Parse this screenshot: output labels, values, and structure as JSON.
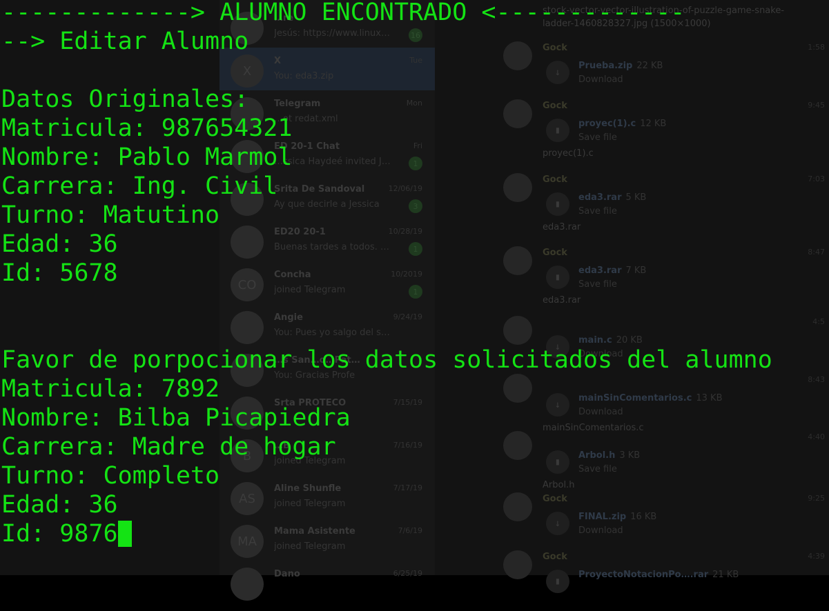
{
  "background_app": {
    "top_filename": "stock-vector-vector-illustration-of-puzzle-game-snake-ladder-1460828327.jpg (1500×1000)",
    "chat_list": [
      {
        "name": "…re",
        "preview": "Jesús: https://www.linuxit…",
        "date": "",
        "badge": "16",
        "avatar": ""
      },
      {
        "name": "X",
        "preview": "You: eda3.zip",
        "date": "Tue",
        "badge": "",
        "avatar": "X"
      },
      {
        "name": "Telegram",
        "preview": "…ot redat.xml",
        "date": "Mon",
        "badge": "",
        "avatar": ""
      },
      {
        "name": "ED 20-1 Chat",
        "preview": "…ssica Haydeé invited Joaquin…",
        "date": "Fri",
        "badge": "1",
        "avatar": ""
      },
      {
        "name": "Srita De Sandoval",
        "preview": "Ay que decirle a Jessica",
        "date": "12/06/19",
        "badge": "3",
        "avatar": ""
      },
      {
        "name": "ED20 20-1",
        "preview": "Buenas tardes a todos. El d…",
        "date": "10/28/19",
        "badge": "1",
        "avatar": ""
      },
      {
        "name": "Concha",
        "preview": "joined Telegram",
        "date": "10/2019",
        "badge": "1",
        "avatar": "CO"
      },
      {
        "name": "Angie",
        "preview": "You: Pues yo salgo del salón…",
        "date": "9/24/19",
        "badge": "",
        "avatar": ""
      },
      {
        "name": "…s San…o…Pat…",
        "preview": "You: Gracias Profe",
        "date": "",
        "badge": "",
        "avatar": ""
      },
      {
        "name": "Srta PROTECO",
        "preview": "",
        "date": "7/15/19",
        "badge": "",
        "avatar": ""
      },
      {
        "name": "…B",
        "preview": "joined Telegram",
        "date": "7/16/19",
        "badge": "",
        "avatar": "B"
      },
      {
        "name": "Aline Shunfle",
        "preview": "joined Telegram",
        "date": "7/17/19",
        "badge": "",
        "avatar": "AS"
      },
      {
        "name": "Mama Asistente",
        "preview": "joined Telegram",
        "date": "7/6/19",
        "badge": "",
        "avatar": "MA"
      },
      {
        "name": "Dano",
        "preview": "",
        "date": "6/25/19",
        "badge": "",
        "avatar": ""
      }
    ],
    "messages": [
      {
        "sender": "Gock",
        "time": "1:58",
        "file": "Prueba.zip",
        "size": "22 KB",
        "action": "Download",
        "caption": ""
      },
      {
        "sender": "Gock",
        "time": "9:45",
        "file": "proyec(1).c",
        "size": "12 KB",
        "action": "Save file",
        "caption": "proyec(1).c"
      },
      {
        "sender": "Gock",
        "time": "7:03",
        "file": "eda3.rar",
        "size": "5 KB",
        "action": "Save file",
        "caption": "eda3.rar"
      },
      {
        "sender": "Gock",
        "time": "8:47",
        "file": "eda3.rar",
        "size": "7 KB",
        "action": "Save file",
        "caption": "eda3.rar"
      },
      {
        "sender": "",
        "time": "4:5",
        "file": "main.c",
        "size": "20 KB",
        "action": "Download",
        "caption": ""
      },
      {
        "sender": "",
        "time": "8:43",
        "file": "mainSinComentarios.c",
        "size": "13 KB",
        "action": "Download",
        "caption": "mainSinComentarios.c"
      },
      {
        "sender": "",
        "time": "4:40",
        "file": "Arbol.h",
        "size": "3 KB",
        "action": "Save file",
        "caption": "Arbol.h"
      },
      {
        "sender": "Gock",
        "time": "9:25",
        "file": "FINAL.zip",
        "size": "16 KB",
        "action": "Download",
        "caption": ""
      },
      {
        "sender": "Gock",
        "time": "4:39",
        "file": "ProyectoNotacionPo….rar",
        "size": "21 KB",
        "action": "",
        "caption": ""
      }
    ]
  },
  "terminal": {
    "lines": [
      "-------------> ALUMNO ENCONTRADO <-------------",
      "--> Editar Alumno",
      "",
      "Datos Originales:",
      "Matricula: 987654321",
      "Nombre: Pablo Marmol",
      "Carrera: Ing. Civil",
      "Turno: Matutino",
      "Edad: 36",
      "Id: 5678",
      "",
      "",
      "Favor de porpocionar los datos solicitados del alumno",
      "Matricula: 7892",
      "Nombre: Bilba Picapiedra",
      "Carrera: Madre de hogar",
      "Turno: Completo",
      "Edad: 36",
      "Id: 9876"
    ],
    "text_color": "#14e314"
  }
}
